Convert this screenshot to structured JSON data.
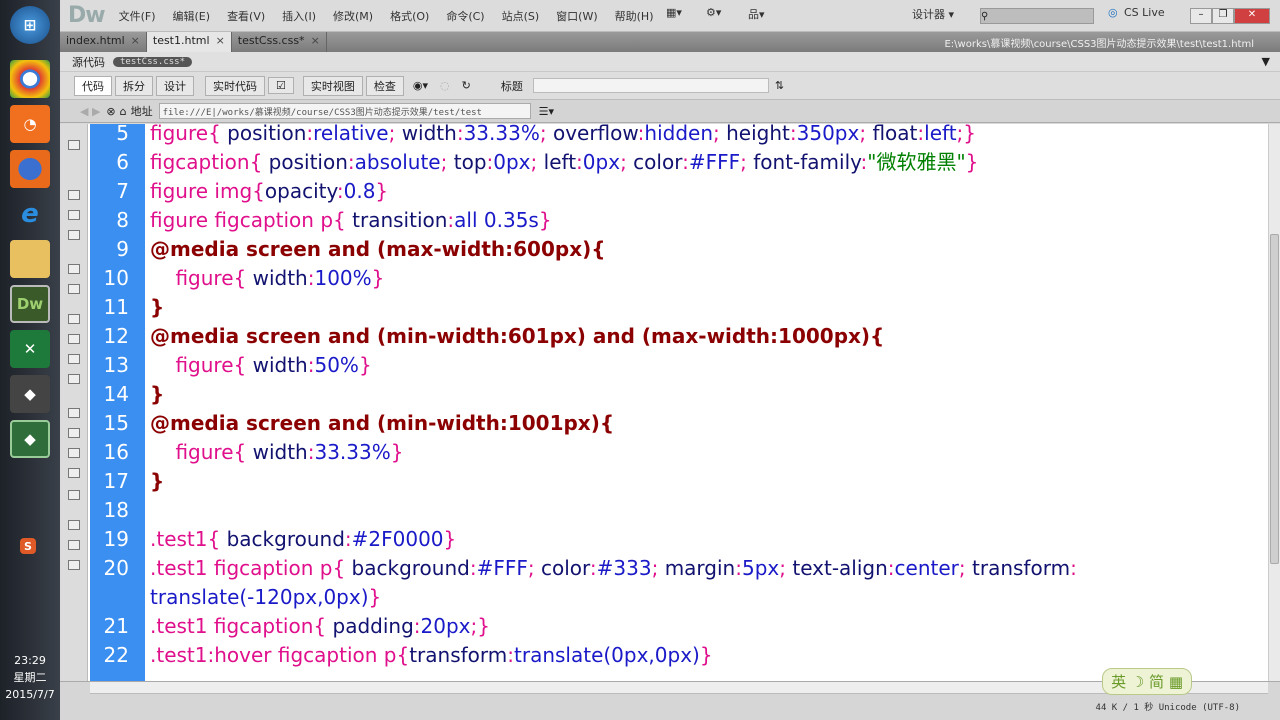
{
  "taskbar": {
    "icons": [
      "chrome",
      "ucweb",
      "firefox",
      "ie",
      "explorer",
      "dreamweaver",
      "excel",
      "app-1",
      "app-2"
    ],
    "dw_label": "Dw",
    "sougou": "S",
    "time": "23:29",
    "weekday": "星期二",
    "date": "2015/7/7"
  },
  "titlebar": {
    "logo": "Dw",
    "menus": [
      "文件(F)",
      "编辑(E)",
      "查看(V)",
      "插入(I)",
      "修改(M)",
      "格式(O)",
      "命令(C)",
      "站点(S)",
      "窗口(W)",
      "帮助(H)"
    ],
    "workspace": "设计器 ▾",
    "cslive": "CS Live"
  },
  "tabs": [
    {
      "label": "index.html"
    },
    {
      "label": "test1.html",
      "active": true
    },
    {
      "label": "testCss.css*"
    }
  ],
  "file_path": "E:\\works\\慕课视频\\course\\CSS3图片动态提示效果\\test\\test1.html",
  "source": {
    "label": "源代码",
    "badge": "testCss.css*"
  },
  "toolbar": {
    "code": "代码",
    "split": "拆分",
    "design": "设计",
    "live_code": "实时代码",
    "live_view": "实时视图",
    "inspect": "检查",
    "title_label": "标题",
    "title_value": ""
  },
  "address": {
    "label": "地址",
    "value": "file:///E|/works/慕课视频/course/CSS3图片动态提示效果/test/test"
  },
  "code": [
    {
      "n": "5",
      "t": [
        [
          "sel",
          "figure"
        ],
        [
          "pun",
          "{ "
        ],
        [
          "prop",
          "position"
        ],
        [
          "pun",
          ":"
        ],
        [
          "val",
          "relative"
        ],
        [
          "pun",
          "; "
        ],
        [
          "prop",
          "width"
        ],
        [
          "pun",
          ":"
        ],
        [
          "val",
          "33.33%"
        ],
        [
          "pun",
          "; "
        ],
        [
          "prop",
          "overflow"
        ],
        [
          "pun",
          ":"
        ],
        [
          "val",
          "hidden"
        ],
        [
          "pun",
          "; "
        ],
        [
          "prop",
          "height"
        ],
        [
          "pun",
          ":"
        ],
        [
          "val",
          "350px"
        ],
        [
          "pun",
          "; "
        ],
        [
          "prop",
          "float"
        ],
        [
          "pun",
          ":"
        ],
        [
          "val",
          "left"
        ],
        [
          "pun",
          ";}"
        ]
      ]
    },
    {
      "n": "6",
      "t": [
        [
          "sel",
          "figcaption"
        ],
        [
          "pun",
          "{ "
        ],
        [
          "prop",
          "position"
        ],
        [
          "pun",
          ":"
        ],
        [
          "val",
          "absolute"
        ],
        [
          "pun",
          "; "
        ],
        [
          "prop",
          "top"
        ],
        [
          "pun",
          ":"
        ],
        [
          "val",
          "0px"
        ],
        [
          "pun",
          "; "
        ],
        [
          "prop",
          "left"
        ],
        [
          "pun",
          ":"
        ],
        [
          "val",
          "0px"
        ],
        [
          "pun",
          "; "
        ],
        [
          "prop",
          "color"
        ],
        [
          "pun",
          ":"
        ],
        [
          "val",
          "#FFF"
        ],
        [
          "pun",
          "; "
        ],
        [
          "prop",
          "font-family"
        ],
        [
          "pun",
          ":"
        ],
        [
          "str",
          "\"微软雅黑\""
        ],
        [
          "pun",
          "}"
        ]
      ]
    },
    {
      "n": "7",
      "t": [
        [
          "sel",
          "figure img"
        ],
        [
          "pun",
          "{"
        ],
        [
          "prop",
          "opacity"
        ],
        [
          "pun",
          ":"
        ],
        [
          "val",
          "0.8"
        ],
        [
          "pun",
          "}"
        ]
      ]
    },
    {
      "n": "8",
      "t": [
        [
          "sel",
          "figure figcaption p"
        ],
        [
          "pun",
          "{ "
        ],
        [
          "prop",
          "transition"
        ],
        [
          "pun",
          ":"
        ],
        [
          "val",
          "all 0.35s"
        ],
        [
          "pun",
          "}"
        ]
      ]
    },
    {
      "n": "9",
      "t": [
        [
          "at",
          "@media screen and (max-width:600px){"
        ]
      ]
    },
    {
      "n": "10",
      "t": [
        [
          "sel",
          "    figure"
        ],
        [
          "pun",
          "{ "
        ],
        [
          "prop",
          "width"
        ],
        [
          "pun",
          ":"
        ],
        [
          "val",
          "100%"
        ],
        [
          "pun",
          "}"
        ]
      ]
    },
    {
      "n": "11",
      "t": [
        [
          "at",
          "}"
        ]
      ]
    },
    {
      "n": "12",
      "t": [
        [
          "at",
          "@media screen and (min-width:601px) and (max-width:1000px){"
        ]
      ]
    },
    {
      "n": "13",
      "t": [
        [
          "sel",
          "    figure"
        ],
        [
          "pun",
          "{ "
        ],
        [
          "prop",
          "width"
        ],
        [
          "pun",
          ":"
        ],
        [
          "val",
          "50%"
        ],
        [
          "pun",
          "}"
        ]
      ]
    },
    {
      "n": "14",
      "t": [
        [
          "at",
          "}"
        ]
      ]
    },
    {
      "n": "15",
      "t": [
        [
          "at",
          "@media screen and (min-width:1001px){"
        ]
      ]
    },
    {
      "n": "16",
      "t": [
        [
          "sel",
          "    figure"
        ],
        [
          "pun",
          "{ "
        ],
        [
          "prop",
          "width"
        ],
        [
          "pun",
          ":"
        ],
        [
          "val",
          "33.33%"
        ],
        [
          "pun",
          "}"
        ]
      ]
    },
    {
      "n": "17",
      "t": [
        [
          "at",
          "}"
        ]
      ]
    },
    {
      "n": "18",
      "t": []
    },
    {
      "n": "19",
      "t": [
        [
          "sel",
          ".test1"
        ],
        [
          "pun",
          "{ "
        ],
        [
          "prop",
          "background"
        ],
        [
          "pun",
          ":"
        ],
        [
          "val",
          "#2F0000"
        ],
        [
          "pun",
          "}"
        ]
      ]
    },
    {
      "n": "20",
      "t": [
        [
          "sel",
          ".test1 figcaption p"
        ],
        [
          "pun",
          "{ "
        ],
        [
          "prop",
          "background"
        ],
        [
          "pun",
          ":"
        ],
        [
          "val",
          "#FFF"
        ],
        [
          "pun",
          "; "
        ],
        [
          "prop",
          "color"
        ],
        [
          "pun",
          ":"
        ],
        [
          "val",
          "#333"
        ],
        [
          "pun",
          "; "
        ],
        [
          "prop",
          "margin"
        ],
        [
          "pun",
          ":"
        ],
        [
          "val",
          "5px"
        ],
        [
          "pun",
          "; "
        ],
        [
          "prop",
          "text-align"
        ],
        [
          "pun",
          ":"
        ],
        [
          "val",
          "center"
        ],
        [
          "pun",
          "; "
        ],
        [
          "prop",
          "transform"
        ],
        [
          "pun",
          ": "
        ],
        [
          "val",
          "translate(-120px,0px)"
        ],
        [
          "pun",
          "}"
        ]
      ]
    },
    {
      "n": "21",
      "t": [
        [
          "sel",
          ".test1 figcaption"
        ],
        [
          "pun",
          "{ "
        ],
        [
          "prop",
          "padding"
        ],
        [
          "pun",
          ":"
        ],
        [
          "val",
          "20px"
        ],
        [
          "pun",
          ";}"
        ]
      ]
    },
    {
      "n": "22",
      "t": [
        [
          "sel",
          ".test1:hover figcaption p"
        ],
        [
          "pun",
          "{"
        ],
        [
          "prop",
          "transform"
        ],
        [
          "pun",
          ":"
        ],
        [
          "val",
          "translate(0px,0px)"
        ],
        [
          "pun",
          "}"
        ]
      ]
    }
  ],
  "status": {
    "info": "44 K / 1 秒 Unicode (UTF-8)",
    "ime": "英 ☽ 简 ▦"
  }
}
